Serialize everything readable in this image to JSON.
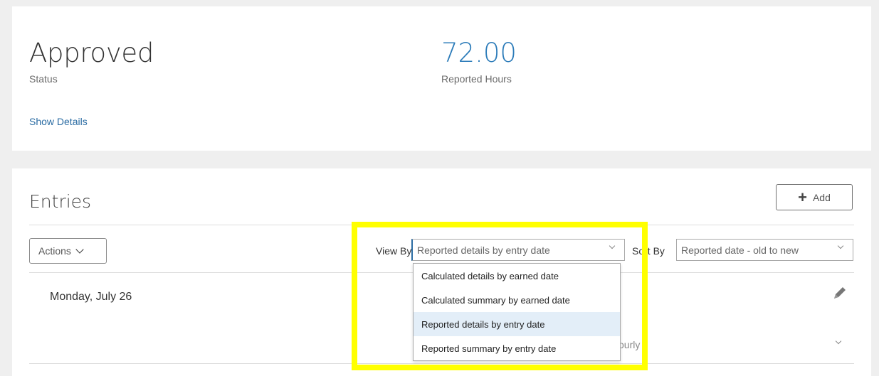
{
  "summary": {
    "status_value": "Approved",
    "status_label": "Status",
    "hours_value": "72.00",
    "hours_label": "Reported Hours",
    "show_details": "Show Details"
  },
  "entries": {
    "title": "Entries",
    "add_label": "Add",
    "actions_label": "Actions",
    "view_by_label": "View By",
    "view_by_value": "Reported details by entry date",
    "sort_by_label": "Sort By",
    "sort_by_value": "Reported date - old to new",
    "day_label": "Monday, July 26",
    "partial_text": "ourly",
    "dropdown_options": [
      "Calculated details by earned date",
      "Calculated summary by earned date",
      "Reported details by entry date",
      "Reported summary by entry date"
    ]
  },
  "colors": {
    "accent": "#2b7bb9",
    "highlight": "#ffff00",
    "selected_option": "#e3eef8"
  },
  "icons": [
    "plus-icon",
    "chevron-down-icon",
    "edit-pencil-icon"
  ]
}
